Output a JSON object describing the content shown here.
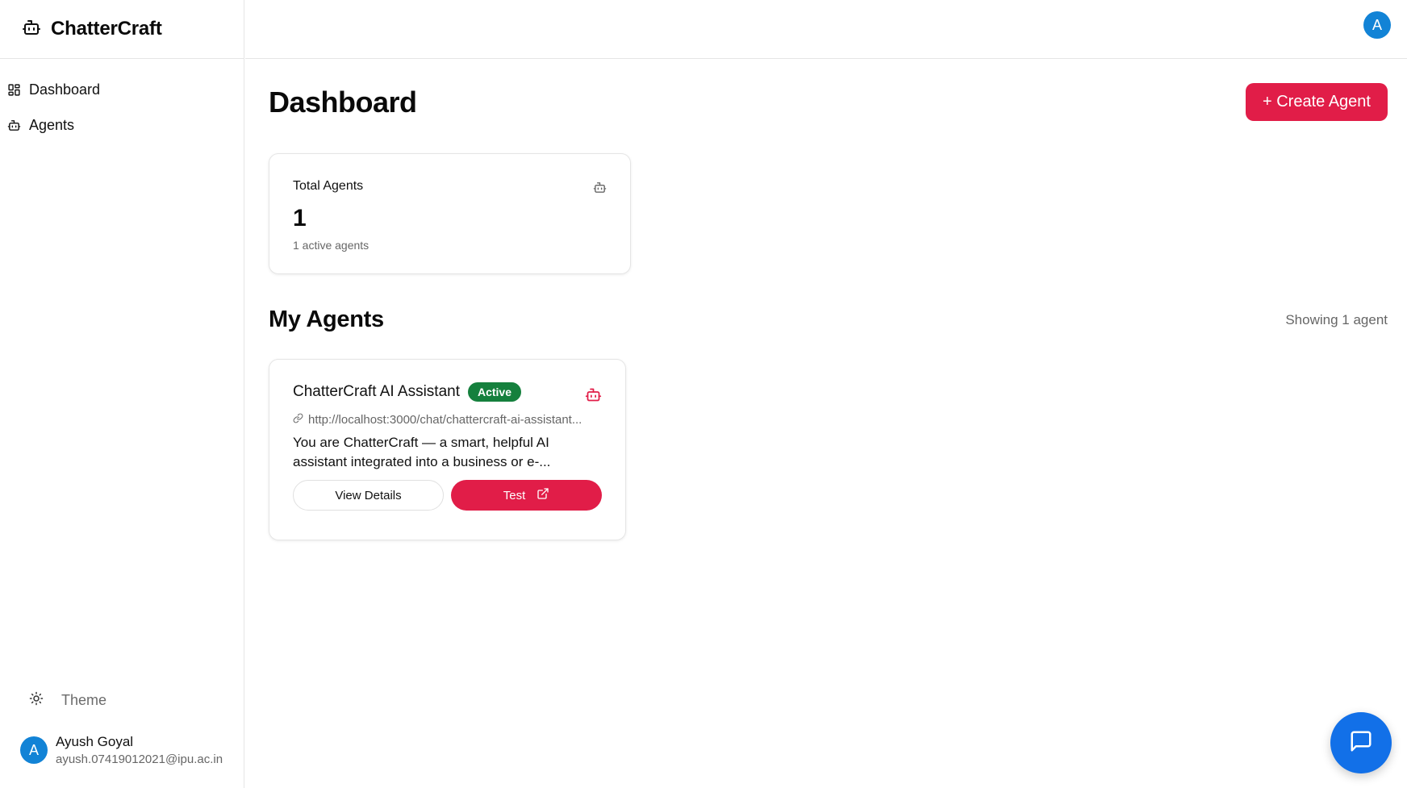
{
  "brand": {
    "name": "ChatterCraft",
    "icon": "bot-icon"
  },
  "sidebar": {
    "items": [
      {
        "label": "Dashboard",
        "icon": "layout-grid-icon"
      },
      {
        "label": "Agents",
        "icon": "bot-icon"
      }
    ],
    "theme_label": "Theme",
    "user": {
      "initial": "A",
      "name": "Ayush Goyal",
      "email": "ayush.07419012021@ipu.ac.in"
    }
  },
  "topbar": {
    "avatar_initial": "A"
  },
  "main": {
    "title": "Dashboard",
    "create_button": "+ Create Agent",
    "stats": {
      "label": "Total Agents",
      "value": "1",
      "sub": "1 active agents"
    },
    "section_title": "My Agents",
    "showing": "Showing 1 agent",
    "agent": {
      "name": "ChatterCraft AI Assistant",
      "status": "Active",
      "url": "http://localhost:3000/chat/chattercraft-ai-assistant...",
      "description_line1": "You are ChatterCraft — a smart, helpful AI",
      "description_line2": "assistant integrated into a business or e-...",
      "view_button": "View Details",
      "test_button": "Test"
    }
  },
  "colors": {
    "accent": "#e11d48",
    "active": "#15803d",
    "avatar": "#1283d6",
    "fab": "#1270e8"
  }
}
